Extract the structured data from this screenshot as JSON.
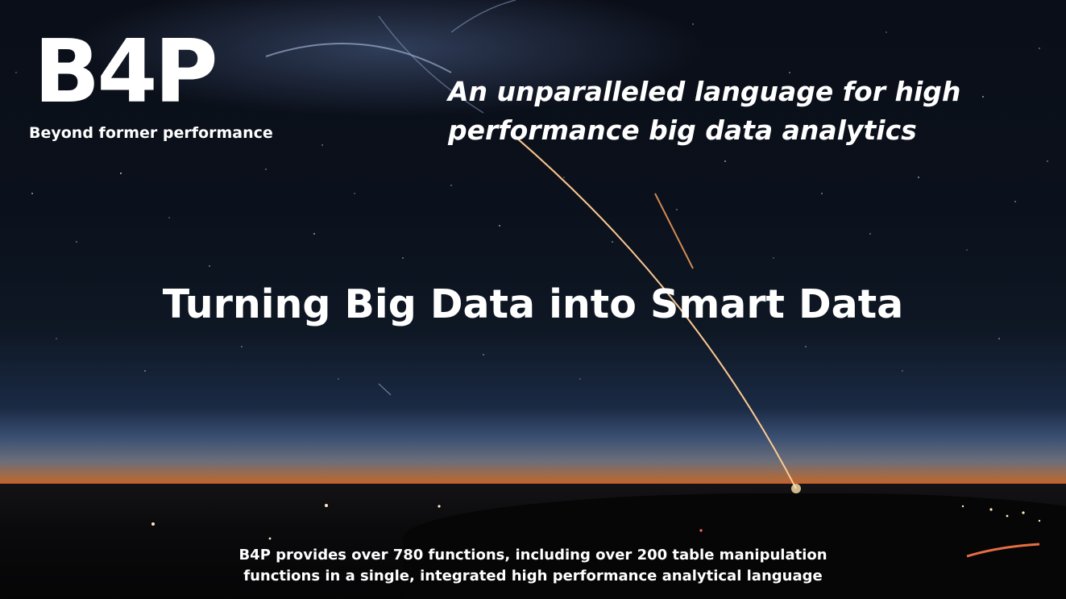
{
  "slide": {
    "logo": "B4P",
    "tagline": "Beyond former performance",
    "headline_line1": "An unparalleled language for high",
    "headline_line2": "performance big data analytics",
    "main_title": "Turning Big Data into Smart Data",
    "footer_line1": "B4P provides over 780 functions, including over 200 table manipulation",
    "footer_line2": "functions in a single, integrated high performance analytical language"
  },
  "colors": {
    "text": "#ffffff",
    "horizon_glow": "#d8562a",
    "night_sky": "#0a0e18",
    "rocket_trail": "#ffd08a"
  }
}
